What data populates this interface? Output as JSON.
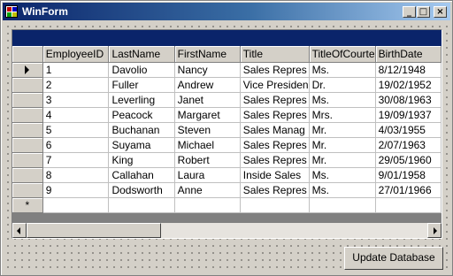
{
  "window": {
    "title": "WinForm",
    "controls": {
      "minimize": "_",
      "maximize": "□",
      "close": "×"
    }
  },
  "grid": {
    "columns": [
      "EmployeeID",
      "LastName",
      "FirstName",
      "Title",
      "TitleOfCourte",
      "BirthDate"
    ],
    "rows": [
      [
        "1",
        "Davolio",
        "Nancy",
        "Sales Repres",
        "Ms.",
        "8/12/1948"
      ],
      [
        "2",
        "Fuller",
        "Andrew",
        "Vice Presiden",
        "Dr.",
        "19/02/1952"
      ],
      [
        "3",
        "Leverling",
        "Janet",
        "Sales Repres",
        "Ms.",
        "30/08/1963"
      ],
      [
        "4",
        "Peacock",
        "Margaret",
        "Sales Repres",
        "Mrs.",
        "19/09/1937"
      ],
      [
        "5",
        "Buchanan",
        "Steven",
        "Sales Manag",
        "Mr.",
        "4/03/1955"
      ],
      [
        "6",
        "Suyama",
        "Michael",
        "Sales Repres",
        "Mr.",
        "2/07/1963"
      ],
      [
        "7",
        "King",
        "Robert",
        "Sales Repres",
        "Mr.",
        "29/05/1960"
      ],
      [
        "8",
        "Callahan",
        "Laura",
        "Inside Sales",
        "Ms.",
        "9/01/1958"
      ],
      [
        "9",
        "Dodsworth",
        "Anne",
        "Sales Repres",
        "Ms.",
        "27/01/1966"
      ]
    ],
    "current_row_index": 0,
    "new_row_marker": "*",
    "caption_color": "#0a246a"
  },
  "actions": {
    "update_label": "Update Database"
  }
}
